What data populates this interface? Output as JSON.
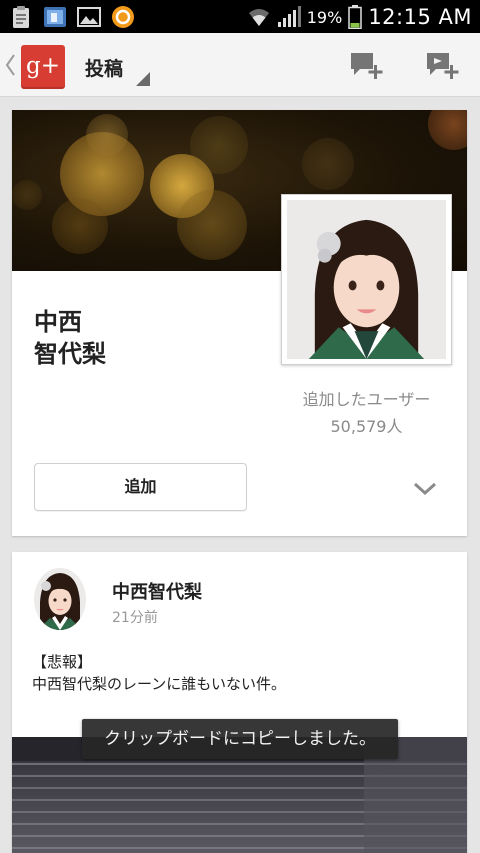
{
  "status_bar": {
    "battery_percent": "19%",
    "time": "12:15 AM",
    "icons": [
      "clipboard-icon",
      "gallery-icon",
      "image-icon",
      "app-icon",
      "wifi-icon",
      "signal-icon",
      "battery-icon"
    ]
  },
  "action_bar": {
    "title": "投稿",
    "app_logo": "g+",
    "actions": [
      "new-message-icon",
      "new-video-message-icon"
    ]
  },
  "profile": {
    "name": "中西\n智代梨",
    "followers_label": "追加したユーザー",
    "followers_count": "50,579人",
    "add_button_label": "追加",
    "expand_icon": "chevron-down-icon"
  },
  "post": {
    "author": "中西智代梨",
    "time": "21分前",
    "body": "【悲報】\n中西智代梨のレーンに誰もいない件。"
  },
  "toast": {
    "message": "クリップボードにコピーしました。"
  },
  "colors": {
    "accent": "#d73d32",
    "background": "#e5e5e5",
    "action_bar": "#f4f4f4",
    "icon_gray": "#757575"
  }
}
